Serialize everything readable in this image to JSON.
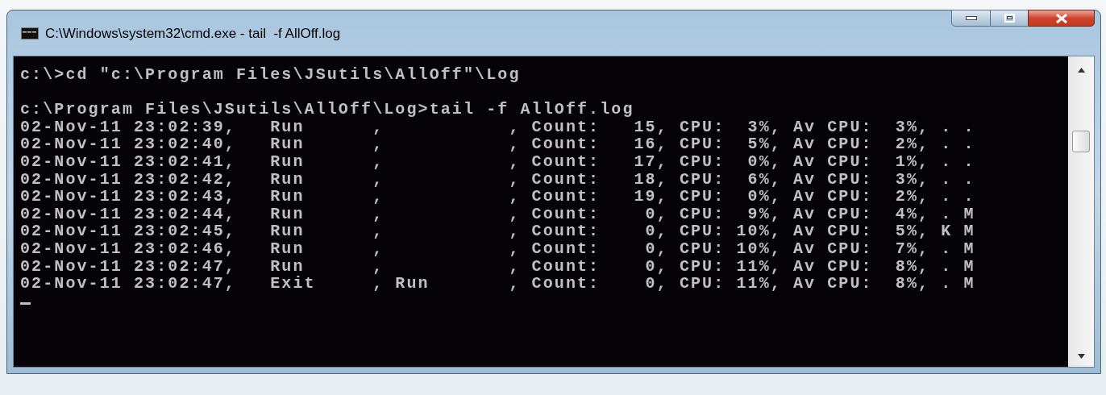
{
  "window": {
    "title": "C:\\Windows\\system32\\cmd.exe - tail  -f AllOff.log"
  },
  "console": {
    "lines": [
      {
        "kind": "text",
        "text": "c:\\>cd \"c:\\Program Files\\JSutils\\AllOff\"\\Log"
      },
      {
        "kind": "blank"
      },
      {
        "kind": "text",
        "text": "c:\\Program Files\\JSutils\\AllOff\\Log>tail -f AllOff.log"
      },
      {
        "kind": "text",
        "text": "02-Nov-11 23:02:39,   Run      ,           , Count:   15, CPU:  3%, Av CPU:  3%, . ."
      },
      {
        "kind": "text",
        "text": "02-Nov-11 23:02:40,   Run      ,           , Count:   16, CPU:  5%, Av CPU:  2%, . ."
      },
      {
        "kind": "text",
        "text": "02-Nov-11 23:02:41,   Run      ,           , Count:   17, CPU:  0%, Av CPU:  1%, . ."
      },
      {
        "kind": "text",
        "text": "02-Nov-11 23:02:42,   Run      ,           , Count:   18, CPU:  6%, Av CPU:  3%, . ."
      },
      {
        "kind": "text",
        "text": "02-Nov-11 23:02:43,   Run      ,           , Count:   19, CPU:  0%, Av CPU:  2%, . ."
      },
      {
        "kind": "text",
        "text": "02-Nov-11 23:02:44,   Run      ,           , Count:    0, CPU:  9%, Av CPU:  4%, . M"
      },
      {
        "kind": "text",
        "text": "02-Nov-11 23:02:45,   Run      ,           , Count:    0, CPU: 10%, Av CPU:  5%, K M"
      },
      {
        "kind": "text",
        "text": "02-Nov-11 23:02:46,   Run      ,           , Count:    0, CPU: 10%, Av CPU:  7%, . M"
      },
      {
        "kind": "text",
        "text": "02-Nov-11 23:02:47,   Run      ,           , Count:    0, CPU: 11%, Av CPU:  8%, . M"
      },
      {
        "kind": "text",
        "text": "02-Nov-11 23:02:47,   Exit     , Run       , Count:    0, CPU: 11%, Av CPU:  8%, . M"
      },
      {
        "kind": "cursor"
      }
    ]
  }
}
